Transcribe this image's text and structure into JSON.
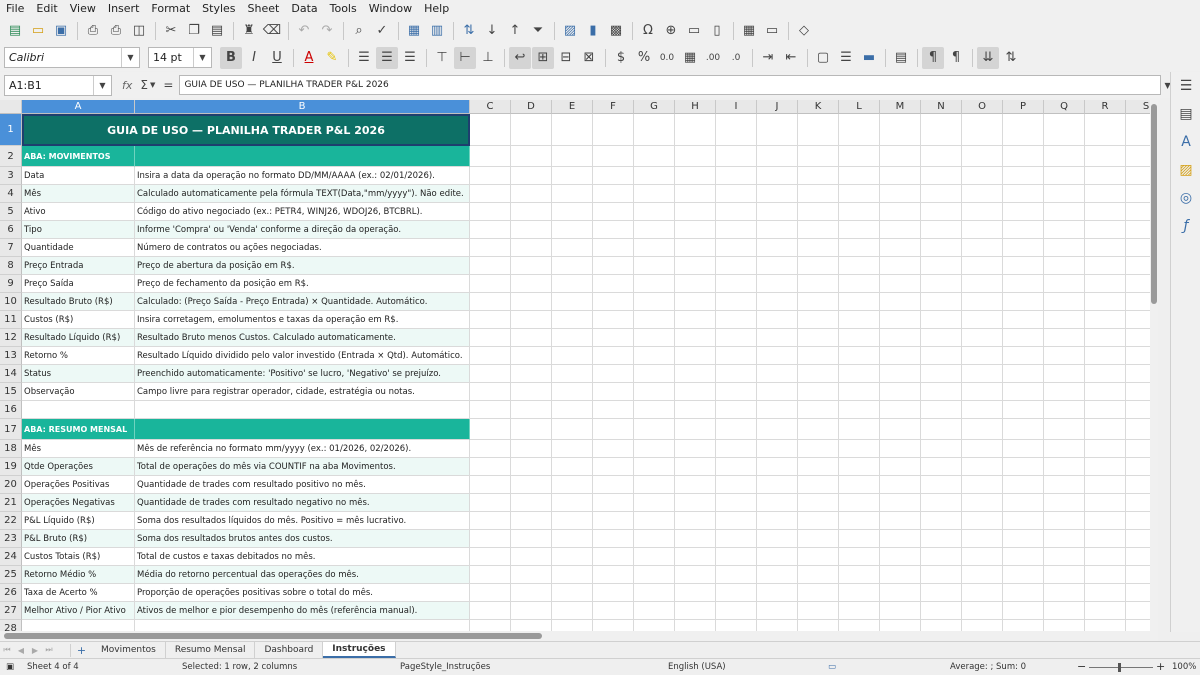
{
  "menu": [
    "File",
    "Edit",
    "View",
    "Insert",
    "Format",
    "Styles",
    "Sheet",
    "Data",
    "Tools",
    "Window",
    "Help"
  ],
  "toolbar": {
    "font_name": "Calibri",
    "font_size": "14 pt",
    "bold": "B",
    "italic": "I",
    "underline": "U",
    "font_color": "A",
    "percent": "%",
    "decimal": "0.0",
    "add_decimal": ".00",
    "remove_decimal": ".0"
  },
  "formula_bar": {
    "name_box": "A1:B1",
    "fx": "fx",
    "sigma": "Σ",
    "equals": "=",
    "content": "GUIA DE USO — PLANILHA TRADER P&L 2026"
  },
  "columns": [
    "A",
    "B",
    "C",
    "D",
    "E",
    "F",
    "G",
    "H",
    "I",
    "J",
    "K",
    "L",
    "M",
    "N",
    "O",
    "P",
    "Q",
    "R",
    "S"
  ],
  "rows": [
    {
      "n": "1",
      "a": "GUIA DE USO — PLANILHA TRADER P&L 2026",
      "b": "",
      "kind": "title"
    },
    {
      "n": "2",
      "a": "ABA: MOVIMENTOS",
      "b": "",
      "kind": "section"
    },
    {
      "n": "3",
      "a": "Data",
      "b": "Insira a data da operação no formato DD/MM/AAAA (ex.: 02/01/2026).",
      "kind": "odd"
    },
    {
      "n": "4",
      "a": "Mês",
      "b": "Calculado automaticamente pela fórmula TEXT(Data,\"mm/yyyy\"). Não edite.",
      "kind": "even"
    },
    {
      "n": "5",
      "a": "Ativo",
      "b": "Código do ativo negociado (ex.: PETR4, WINJ26, WDOJ26, BTCBRL).",
      "kind": "odd"
    },
    {
      "n": "6",
      "a": "Tipo",
      "b": "Informe 'Compra' ou 'Venda' conforme a direção da operação.",
      "kind": "even"
    },
    {
      "n": "7",
      "a": "Quantidade",
      "b": "Número de contratos ou ações negociadas.",
      "kind": "odd"
    },
    {
      "n": "8",
      "a": "Preço Entrada",
      "b": "Preço de abertura da posição em R$.",
      "kind": "even"
    },
    {
      "n": "9",
      "a": "Preço Saída",
      "b": "Preço de fechamento da posição em R$.",
      "kind": "odd"
    },
    {
      "n": "10",
      "a": "Resultado Bruto (R$)",
      "b": "Calculado: (Preço Saída - Preço Entrada) × Quantidade. Automático.",
      "kind": "even"
    },
    {
      "n": "11",
      "a": "Custos (R$)",
      "b": "Insira corretagem, emolumentos e taxas da operação em R$.",
      "kind": "odd"
    },
    {
      "n": "12",
      "a": "Resultado Líquido (R$)",
      "b": "Resultado Bruto menos Custos. Calculado automaticamente.",
      "kind": "even"
    },
    {
      "n": "13",
      "a": "Retorno %",
      "b": "Resultado Líquido dividido pelo valor investido (Entrada × Qtd). Automático.",
      "kind": "odd"
    },
    {
      "n": "14",
      "a": "Status",
      "b": "Preenchido automaticamente: 'Positivo' se lucro, 'Negativo' se prejuízo.",
      "kind": "even"
    },
    {
      "n": "15",
      "a": "Observação",
      "b": "Campo livre para registrar operador, cidade, estratégia ou notas.",
      "kind": "odd"
    },
    {
      "n": "16",
      "a": "",
      "b": "",
      "kind": "blank"
    },
    {
      "n": "17",
      "a": "ABA: RESUMO MENSAL",
      "b": "",
      "kind": "section"
    },
    {
      "n": "18",
      "a": "Mês",
      "b": "Mês de referência no formato mm/yyyy (ex.: 01/2026, 02/2026).",
      "kind": "odd"
    },
    {
      "n": "19",
      "a": "Qtde Operações",
      "b": "Total de operações do mês via COUNTIF na aba Movimentos.",
      "kind": "even"
    },
    {
      "n": "20",
      "a": "Operações Positivas",
      "b": "Quantidade de trades com resultado positivo no mês.",
      "kind": "odd"
    },
    {
      "n": "21",
      "a": "Operações Negativas",
      "b": "Quantidade de trades com resultado negativo no mês.",
      "kind": "even"
    },
    {
      "n": "22",
      "a": "P&L Líquido (R$)",
      "b": "Soma dos resultados líquidos do mês. Positivo = mês lucrativo.",
      "kind": "odd"
    },
    {
      "n": "23",
      "a": "P&L Bruto (R$)",
      "b": "Soma dos resultados brutos antes dos custos.",
      "kind": "even"
    },
    {
      "n": "24",
      "a": "Custos Totais (R$)",
      "b": "Total de custos e taxas debitados no mês.",
      "kind": "odd"
    },
    {
      "n": "25",
      "a": "Retorno Médio %",
      "b": "Média do retorno percentual das operações do mês.",
      "kind": "even"
    },
    {
      "n": "26",
      "a": "Taxa de Acerto %",
      "b": "Proporção de operações positivas sobre o total do mês.",
      "kind": "odd"
    },
    {
      "n": "27",
      "a": "Melhor Ativo / Pior Ativo",
      "b": "Ativos de melhor e pior desempenho do mês (referência manual).",
      "kind": "even"
    },
    {
      "n": "28",
      "a": "",
      "b": "",
      "kind": "blank"
    }
  ],
  "sheets": [
    "Movimentos",
    "Resumo Mensal",
    "Dashboard",
    "Instruções"
  ],
  "active_sheet": "Instruções",
  "status": {
    "sheet": "Sheet 4 of 4",
    "selection": "Selected: 1 row, 2 columns",
    "page_style": "PageStyle_Instruções",
    "language": "English (USA)",
    "sum": "Average: ; Sum: 0",
    "zoom": "100%",
    "zoom_minus": "−",
    "zoom_plus": "+"
  },
  "colors": {
    "title_bg": "#0d7066",
    "section_bg": "#19b59b",
    "even_row": "#edf9f6",
    "odd_row": "#ffffff",
    "selection": "#4a90d9"
  }
}
